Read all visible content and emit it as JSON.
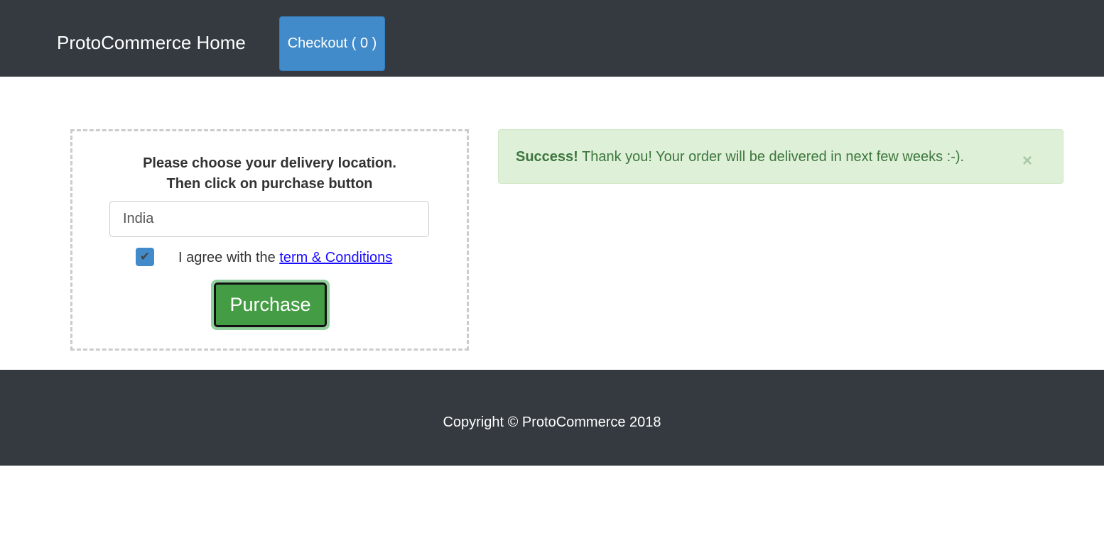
{
  "nav": {
    "brand": "ProtoCommerce Home",
    "checkout": "Checkout ( 0 )"
  },
  "form": {
    "heading1": "Please choose your delivery location.",
    "heading2": "Then click on purchase button",
    "country_value": "India",
    "agree_text": "I agree with the ",
    "terms_link": "term & Conditions",
    "checkbox_checked": true,
    "purchase": "Purchase"
  },
  "alert": {
    "strong": "Success!",
    "message": " Thank you! Your order will be delivered in next few weeks :-).",
    "close": "×"
  },
  "footer": {
    "copyright": "Copyright © ProtoCommerce 2018"
  }
}
